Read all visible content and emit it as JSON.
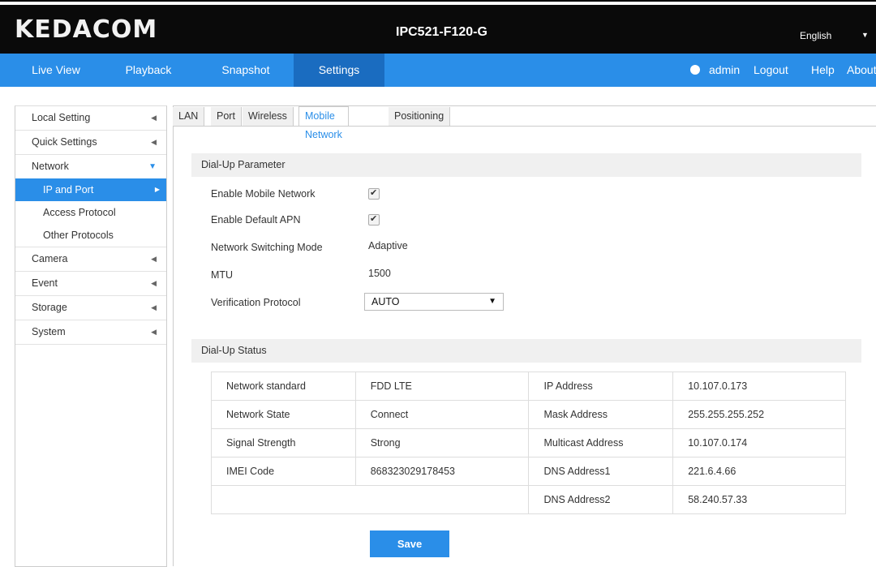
{
  "header": {
    "logo": "KEDACOM",
    "model": "IPC521-F120-G",
    "language": "English"
  },
  "nav": {
    "items": [
      "Live View",
      "Playback",
      "Snapshot",
      "Settings"
    ],
    "active": "Settings",
    "user": "admin",
    "logout": "Logout",
    "help": "Help",
    "about": "About"
  },
  "sidebar": {
    "items": [
      "Local Setting",
      "Quick Settings",
      "Network",
      "Camera",
      "Event",
      "Storage",
      "System"
    ],
    "network_sub": [
      "IP and Port",
      "Access Protocol",
      "Other Protocols"
    ]
  },
  "tabs": [
    "LAN",
    "Port",
    "Wireless",
    "Mobile Network",
    "Positioning"
  ],
  "dialup": {
    "title": "Dial-Up Parameter",
    "enable_mobile_label": "Enable Mobile Network",
    "enable_mobile_checked": true,
    "enable_apn_label": "Enable Default APN",
    "enable_apn_checked": true,
    "switching_label": "Network Switching Mode",
    "switching_value": "Adaptive",
    "mtu_label": "MTU",
    "mtu_value": "1500",
    "verification_label": "Verification Protocol",
    "verification_value": "AUTO"
  },
  "status": {
    "title": "Dial-Up Status",
    "rows": [
      [
        "Network standard",
        "FDD LTE",
        "IP Address",
        "10.107.0.173"
      ],
      [
        "Network State",
        "Connect",
        "Mask Address",
        "255.255.255.252"
      ],
      [
        "Signal Strength",
        "Strong",
        "Multicast Address",
        "10.107.0.174"
      ],
      [
        "IMEI Code",
        "868323029178453",
        "DNS Address1",
        "221.6.4.66"
      ],
      [
        "",
        "",
        "DNS Address2",
        "58.240.57.33"
      ]
    ]
  },
  "save_label": "Save",
  "colors": {
    "accent": "#2a8ee8",
    "nav_active": "#1a6cc0",
    "header_bg": "#0a0a0a"
  }
}
